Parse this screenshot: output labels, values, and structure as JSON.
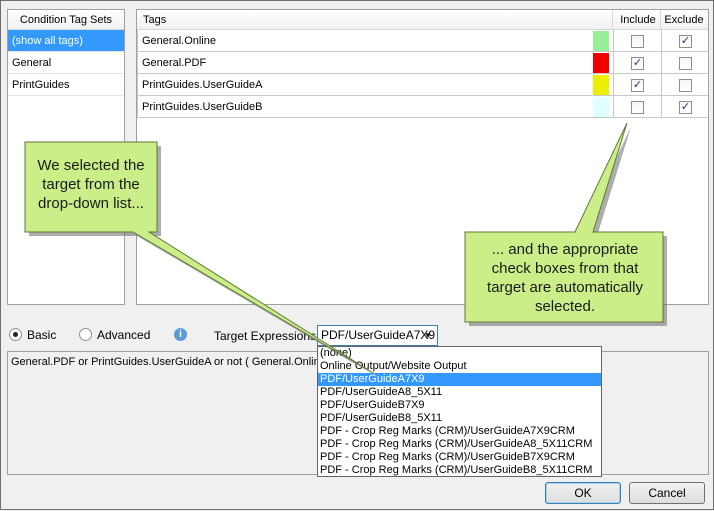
{
  "left_panel": {
    "header": "Condition Tag Sets",
    "items": [
      "(show all tags)",
      "General",
      "PrintGuides"
    ],
    "selected_index": 0
  },
  "grid": {
    "headers": {
      "tags": "Tags",
      "include": "Include",
      "exclude": "Exclude"
    },
    "rows": [
      {
        "name": "General.Online",
        "color": "#99ee99",
        "include": false,
        "exclude": true
      },
      {
        "name": "General.PDF",
        "color": "#ee0000",
        "include": true,
        "exclude": false
      },
      {
        "name": "PrintGuides.UserGuideA",
        "color": "#eeee00",
        "include": true,
        "exclude": false
      },
      {
        "name": "PrintGuides.UserGuideB",
        "color": "#e0ffff",
        "include": false,
        "exclude": true
      }
    ]
  },
  "controls": {
    "basic_label": "Basic",
    "advanced_label": "Advanced",
    "mode_selected": "basic",
    "info_icon_glyph": "i",
    "target_label": "Target Expressions:",
    "target_value": "PDF/UserGuideA7X9"
  },
  "expression": {
    "text": "General.PDF or PrintGuides.UserGuideA or not ( General.Online o"
  },
  "dropdown": {
    "options": [
      "(none)",
      "Online Output/Website Output",
      "PDF/UserGuideA7X9",
      "PDF/UserGuideA8_5X11",
      "PDF/UserGuideB7X9",
      "PDF/UserGuideB8_5X11",
      "PDF - Crop Reg Marks (CRM)/UserGuideA7X9CRM",
      "PDF - Crop Reg Marks (CRM)/UserGuideA8_5X11CRM",
      "PDF - Crop Reg Marks (CRM)/UserGuideB7X9CRM",
      "PDF - Crop Reg Marks (CRM)/UserGuideB8_5X11CRM"
    ],
    "selected_index": 2
  },
  "buttons": {
    "ok": "OK",
    "cancel": "Cancel"
  },
  "callouts": {
    "left": "We selected the target from the drop-down list...",
    "right": "... and the appropriate check boxes from that target are automatically selected.",
    "fill_color": "#ccee88"
  }
}
